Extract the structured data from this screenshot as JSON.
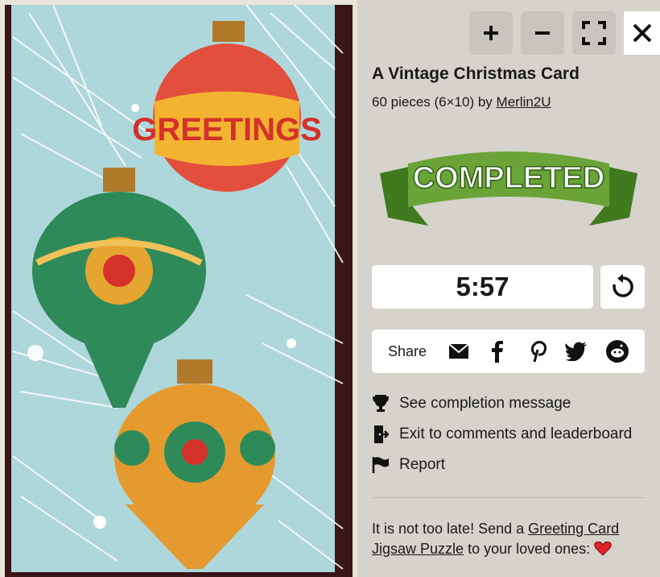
{
  "toolbar": {
    "zoom_in_label": "+",
    "zoom_out_label": "−",
    "close_label": "✕"
  },
  "puzzle": {
    "title": "A Vintage Christmas Card",
    "pieces_text": "60 pieces (6×10) by",
    "author": "Merlin2U",
    "ornament_text": "GREETINGS"
  },
  "banner": {
    "label": "COMPLETED",
    "colors": {
      "ribbon": "#6aa338",
      "ribbon_dark": "#3f7a1f",
      "text": "#ffffff"
    }
  },
  "timer": {
    "value": "5:57"
  },
  "share": {
    "label": "Share",
    "icons": [
      "mail-icon",
      "facebook-icon",
      "pinterest-icon",
      "twitter-icon",
      "reddit-icon"
    ]
  },
  "links": [
    {
      "icon": "trophy-icon",
      "label": "See completion message"
    },
    {
      "icon": "exit-icon",
      "label": "Exit to comments and leaderboard"
    },
    {
      "icon": "flag-icon",
      "label": "Report"
    }
  ],
  "promo": {
    "prefix": "It is not too late! Send a",
    "link": "Greeting Card Jigsaw Puzzle",
    "suffix": "to your loved ones:"
  }
}
